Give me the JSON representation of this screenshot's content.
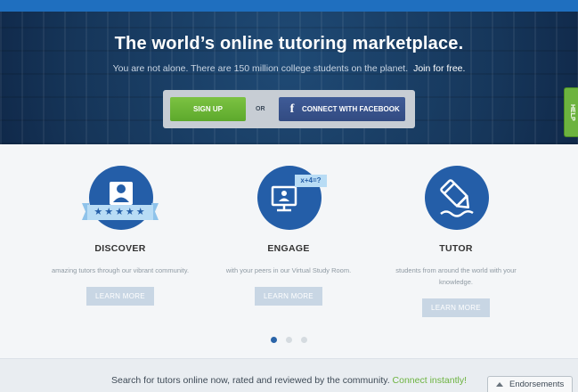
{
  "hero": {
    "title": "The world’s online tutoring marketplace.",
    "subtitle": "You are not alone. There are 150 million college students on the planet.",
    "join_link": "Join for free.",
    "signup_label": "SIGN UP",
    "or_label": "OR",
    "facebook_label": "CONNECT WITH FACEBOOK",
    "facebook_icon": "f"
  },
  "help_tab": {
    "label": "HELP"
  },
  "features": [
    {
      "title": "DISCOVER",
      "description": "amazing tutors through our vibrant community.",
      "button": "LEARN MORE",
      "icon": "profile-stars-icon",
      "stars": "★★★★★"
    },
    {
      "title": "ENGAGE",
      "description": "with your peers in our Virtual Study Room.",
      "button": "LEARN MORE",
      "icon": "whiteboard-icon",
      "equation": "x+4=?"
    },
    {
      "title": "TUTOR",
      "description": "students from around the world with your knowledge.",
      "button": "LEARN MORE",
      "icon": "pencil-icon"
    }
  ],
  "carousel": {
    "pages": 3,
    "active": 1
  },
  "bottom": {
    "text": "Search for tutors online now, rated and reviewed by the community.",
    "link": "Connect instantly!",
    "endorsements": "Endorsements"
  },
  "colors": {
    "hero_bg": "#183a5e",
    "accent_green": "#6cb33f",
    "feature_blue": "#245ea8",
    "facebook_blue": "#3b5998"
  }
}
